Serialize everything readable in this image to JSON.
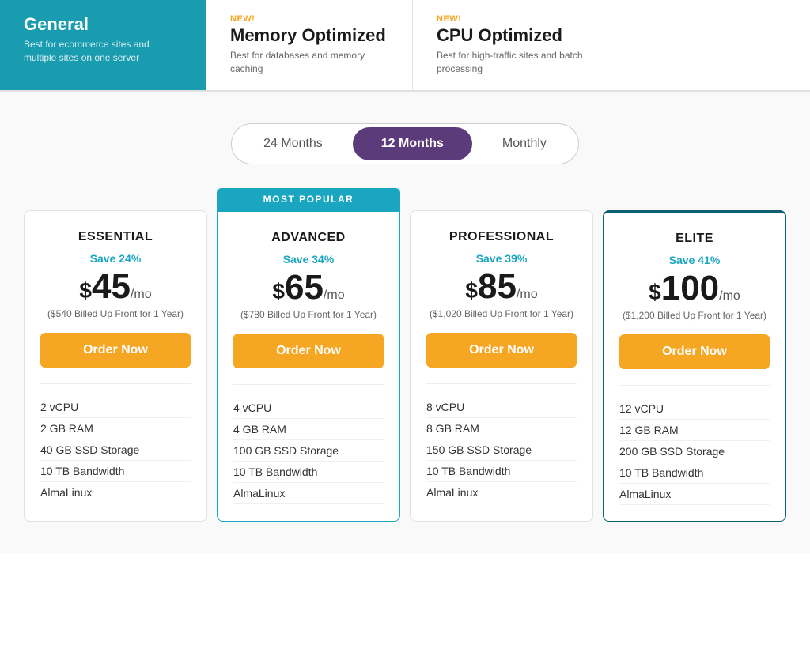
{
  "topTabs": [
    {
      "id": "general",
      "new": false,
      "title": "General",
      "desc": "Best for ecommerce sites and multiple sites on one server",
      "active": true
    },
    {
      "id": "memory",
      "new": true,
      "newLabel": "NEW!",
      "title": "Memory Optimized",
      "desc": "Best for databases and memory caching",
      "active": false
    },
    {
      "id": "cpu",
      "new": true,
      "newLabel": "NEW!",
      "title": "CPU Optimized",
      "desc": "Best for high-traffic sites and batch processing",
      "active": false
    }
  ],
  "billingOptions": [
    {
      "id": "24months",
      "label": "24 Months",
      "active": false
    },
    {
      "id": "12months",
      "label": "12 Months",
      "active": true
    },
    {
      "id": "monthly",
      "label": "Monthly",
      "active": false
    }
  ],
  "popularBadge": "MOST POPULAR",
  "plans": [
    {
      "id": "essential",
      "name": "ESSENTIAL",
      "save": "Save 24%",
      "price": "45",
      "mo": "/mo",
      "billed": "($540 Billed Up Front for 1 Year)",
      "orderLabel": "Order Now",
      "popular": false,
      "elite": false,
      "features": [
        "2 vCPU",
        "2 GB RAM",
        "40 GB SSD Storage",
        "10 TB Bandwidth",
        "AlmaLinux"
      ]
    },
    {
      "id": "advanced",
      "name": "ADVANCED",
      "save": "Save 34%",
      "price": "65",
      "mo": "/mo",
      "billed": "($780 Billed Up Front for 1 Year)",
      "orderLabel": "Order Now",
      "popular": true,
      "elite": false,
      "features": [
        "4 vCPU",
        "4 GB RAM",
        "100 GB SSD Storage",
        "10 TB Bandwidth",
        "AlmaLinux"
      ]
    },
    {
      "id": "professional",
      "name": "PROFESSIONAL",
      "save": "Save 39%",
      "price": "85",
      "mo": "/mo",
      "billed": "($1,020 Billed Up Front for 1 Year)",
      "orderLabel": "Order Now",
      "popular": false,
      "elite": false,
      "features": [
        "8 vCPU",
        "8 GB RAM",
        "150 GB SSD Storage",
        "10 TB Bandwidth",
        "AlmaLinux"
      ]
    },
    {
      "id": "elite",
      "name": "ELITE",
      "save": "Save 41%",
      "price": "100",
      "mo": "/mo",
      "billed": "($1,200 Billed Up Front for 1 Year)",
      "orderLabel": "Order Now",
      "popular": false,
      "elite": true,
      "features": [
        "12 vCPU",
        "12 GB RAM",
        "200 GB SSD Storage",
        "10 TB Bandwidth",
        "AlmaLinux"
      ]
    }
  ]
}
